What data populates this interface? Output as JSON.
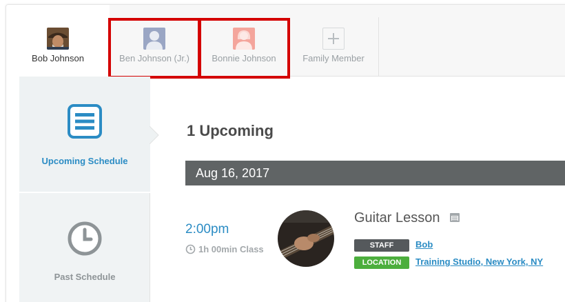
{
  "family": {
    "members": [
      {
        "name": "Bob Johnson",
        "icon": "user-photo-icon"
      },
      {
        "name": "Ben Johnson (Jr.)",
        "icon": "male-avatar-icon"
      },
      {
        "name": "Bonnie Johnson",
        "icon": "female-avatar-icon"
      },
      {
        "name": "Family Member",
        "icon": "plus-icon"
      }
    ],
    "highlight_color": "#d40000"
  },
  "sidebar": {
    "items": [
      {
        "label": "Upcoming Schedule",
        "icon": "list-icon",
        "color": "#2b8cc4"
      },
      {
        "label": "Past Schedule",
        "icon": "clock-icon",
        "color": "#8e9497"
      }
    ]
  },
  "main": {
    "count_heading": "1 Upcoming",
    "date": "Aug 16, 2017",
    "event": {
      "time": "2:00pm",
      "duration": "1h 00min Class",
      "title": "Guitar Lesson",
      "staff_label": "STAFF",
      "staff_name": "Bob",
      "location_label": "LOCATION",
      "location_name": "Training Studio, New York, NY"
    }
  },
  "colors": {
    "accent": "#2b8cc4",
    "staff_tag": "#55595c",
    "location_tag": "#4cae3d",
    "date_bar": "#606465"
  }
}
